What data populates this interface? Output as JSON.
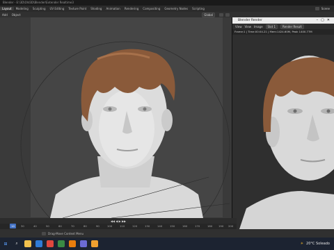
{
  "window": {
    "title": "Blender - E:\\3D\\Old3D\\Blender\\Extender Realtime3"
  },
  "menubar": {
    "items": [
      "Layout",
      "Modeling",
      "Sculpting",
      "UV Editing",
      "Texture Paint",
      "Shading",
      "Animation",
      "Rendering",
      "Compositing",
      "Geometry Nodes",
      "Scripting"
    ],
    "active_index": 0,
    "scene_label": "Scene"
  },
  "viewport_header": {
    "mode": "Add",
    "object": "Object",
    "orientation": "Global"
  },
  "render_window": {
    "title": "Blender Render",
    "menu": [
      "View",
      "View",
      "Image"
    ],
    "slot": "Slot 1",
    "pass": "Render Result",
    "info": "Frame:1 | Time:00:04.21 | Mem:1424.60M, Peak 1400.77M"
  },
  "timeline": {
    "current_frame": "10",
    "ticks": [
      "30",
      "40",
      "50",
      "60",
      "70",
      "80",
      "90",
      "100",
      "110",
      "120",
      "130",
      "140",
      "150",
      "160",
      "170",
      "180",
      "190",
      "200"
    ]
  },
  "statusbar": {
    "hint": "Drag-Move Context Menu"
  },
  "taskbar": {
    "weather": "20°C Soleado"
  },
  "colors": {
    "accent": "#4472c4",
    "hair": "#8a5a3a",
    "skin": "#d8d8d8"
  }
}
